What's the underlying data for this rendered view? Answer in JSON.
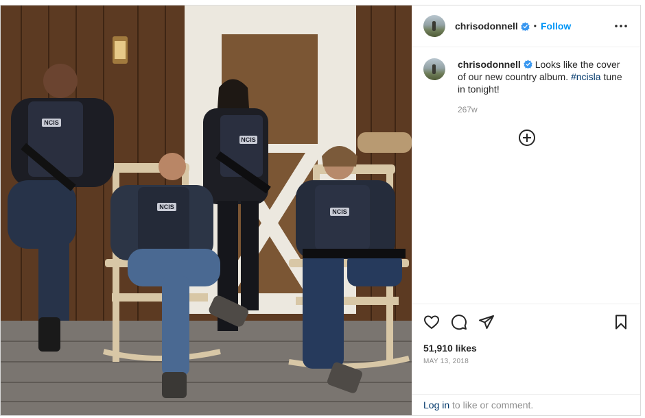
{
  "post": {
    "username": "chrisodonnell",
    "follow_label": "Follow",
    "separator": "•",
    "caption": {
      "text_before": "Looks like the cover of our new country album.",
      "hashtag": "#ncisla",
      "text_after": "tune in tonight!"
    },
    "time_ago": "267w",
    "likes": "51,910 likes",
    "date": "MAY 13, 2018",
    "login": {
      "link": "Log in",
      "text": "to like or comment."
    },
    "vest_label": "NCIS"
  },
  "colors": {
    "accent": "#0095f6",
    "hashtag": "#00376b",
    "muted": "#8e8e8e",
    "verified": "#3897f0"
  }
}
